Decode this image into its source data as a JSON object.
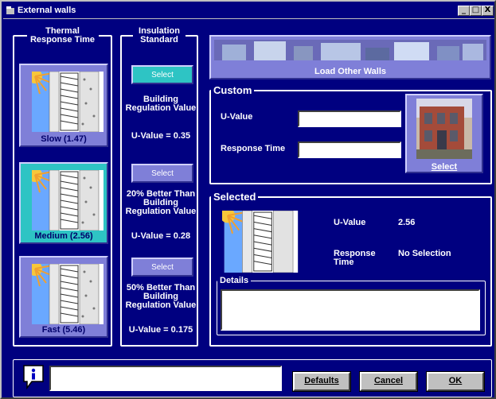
{
  "window": {
    "title": "External walls",
    "minimize": "_",
    "maximize": "□",
    "close": "X"
  },
  "thermal": {
    "legend": "Thermal Response Time",
    "items": [
      {
        "label": "Slow (1.47)"
      },
      {
        "label": "Medium (2.56)",
        "selected": true
      },
      {
        "label": "Fast (5.46)"
      }
    ]
  },
  "insulation": {
    "legend": "Insulation Standard",
    "options": [
      {
        "button": "Select",
        "title": "Building Regulation Value",
        "uvalue": "U-Value = 0.35"
      },
      {
        "button": "Select",
        "title": "20% Better Than Building Regulation Value",
        "uvalue": "U-Value = 0.28"
      },
      {
        "button": "Select",
        "title": "50% Better Than Building Regulation Value",
        "uvalue": "U-Value = 0.175"
      }
    ]
  },
  "load_other": {
    "label": "Load Other Walls"
  },
  "custom": {
    "legend": "Custom",
    "uvalue_label": "U-Value",
    "uvalue_value": "",
    "response_label": "Response Time",
    "response_value": "",
    "select_label": "Select"
  },
  "selected": {
    "legend": "Selected",
    "uvalue_label": "U-Value",
    "uvalue_value": "2.56",
    "response_label": "Response Time",
    "response_value": "No Selection",
    "details_legend": "Details",
    "details_text": ""
  },
  "footer": {
    "info_icon": "info-icon",
    "status_text": "",
    "defaults": "Defaults",
    "cancel": "Cancel",
    "ok": "OK"
  },
  "colors": {
    "window_bg": "#000080",
    "card": "#7f7fd8",
    "teal": "#2ec4c4"
  }
}
